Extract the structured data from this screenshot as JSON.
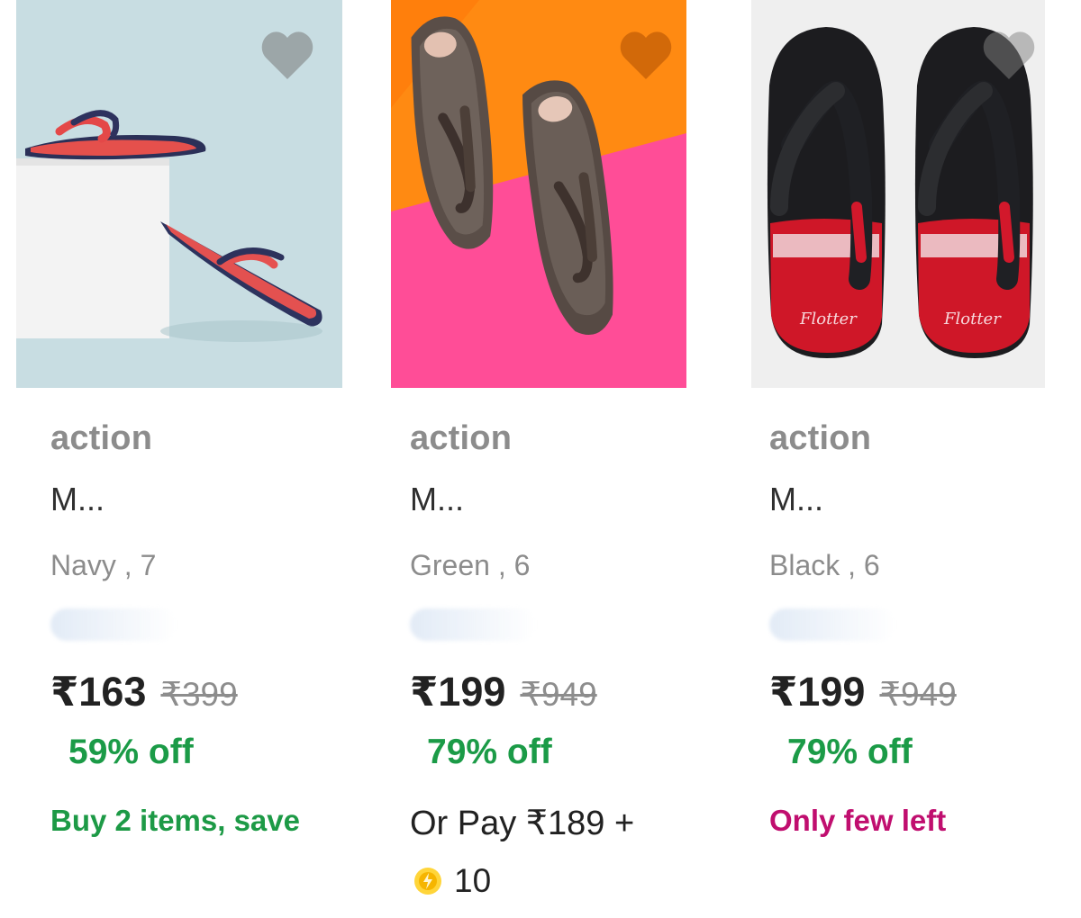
{
  "colors": {
    "discount": "#1b9b47",
    "accent_offer": "#1d9a46",
    "stock_alert": "#c00e6f",
    "muted_text": "#8c8c8c"
  },
  "products": [
    {
      "brand": "action",
      "title": "M...",
      "variant": "Navy , 7",
      "price": "₹163",
      "mrp": "₹399",
      "discount": "59% off",
      "offer": "Buy 2 items, save",
      "image": "navy-red-flip-flop-on-white-block",
      "wishlist_icon": "heart-icon"
    },
    {
      "brand": "action",
      "title": "M...",
      "variant": "Green , 6",
      "price": "₹199",
      "mrp": "₹949",
      "discount": "79% off",
      "pay_text": "Or Pay ₹189 +",
      "coin_amount": "10",
      "coin_icon": "supercoin-icon",
      "image": "dark-brown-flip-flops-on-orange-pink",
      "wishlist_icon": "heart-icon"
    },
    {
      "brand": "action",
      "title": "M...",
      "variant": "Black , 6",
      "price": "₹199",
      "mrp": "₹949",
      "discount": "79% off",
      "offer": "Only few left",
      "image_text": "Flotter",
      "image": "black-red-flip-flops-on-gray",
      "wishlist_icon": "heart-icon"
    }
  ]
}
